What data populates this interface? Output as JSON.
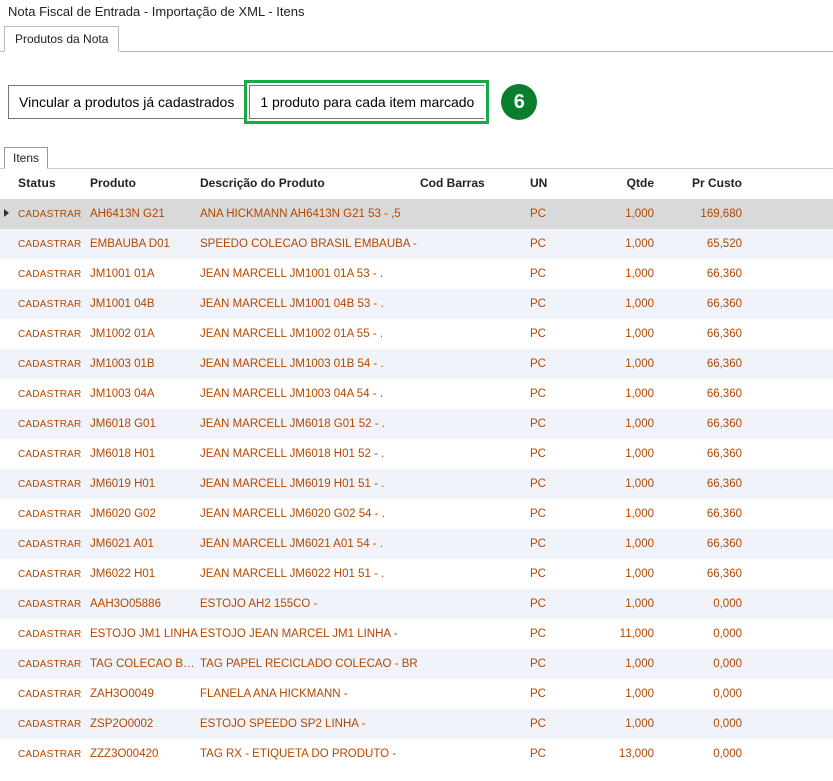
{
  "window": {
    "title": "Nota Fiscal de Entrada - Importação de XML - Itens"
  },
  "tabs_outer": {
    "active": "Produtos da Nota"
  },
  "toolbar": {
    "btn_link": "Vincular a produtos já cadastrados",
    "btn_create": "1 produto para cada item marcado"
  },
  "callout": {
    "number": "6"
  },
  "subtabs": {
    "active": "Itens"
  },
  "grid": {
    "columns": {
      "status": "Status",
      "produto": "Produto",
      "descricao": "Descrição do Produto",
      "cod_barras": "Cod Barras",
      "un": "UN",
      "qtde": "Qtde",
      "pr_custo": "Pr Custo"
    },
    "status_label": "CADASTRAR",
    "rows": [
      {
        "selected": true,
        "produto": "AH6413N G21",
        "descricao": "ANA HICKMANN AH6413N G21 53 - ,5",
        "un": "PC",
        "qtde": "1,000",
        "custo": "169,680"
      },
      {
        "selected": false,
        "produto": "EMBAUBA D01",
        "descricao": "SPEEDO COLECAO BRASIL EMBAUBA - ",
        "un": "PC",
        "qtde": "1,000",
        "custo": "65,520"
      },
      {
        "selected": false,
        "produto": "JM1001 01A",
        "descricao": "JEAN MARCELL JM1001 01A 53 - .",
        "un": "PC",
        "qtde": "1,000",
        "custo": "66,360"
      },
      {
        "selected": false,
        "produto": "JM1001 04B",
        "descricao": "JEAN MARCELL JM1001 04B 53 - .",
        "un": "PC",
        "qtde": "1,000",
        "custo": "66,360"
      },
      {
        "selected": false,
        "produto": "JM1002 01A",
        "descricao": "JEAN MARCELL JM1002 01A 55 - .",
        "un": "PC",
        "qtde": "1,000",
        "custo": "66,360"
      },
      {
        "selected": false,
        "produto": "JM1003 01B",
        "descricao": "JEAN MARCELL JM1003 01B 54 - .",
        "un": "PC",
        "qtde": "1,000",
        "custo": "66,360"
      },
      {
        "selected": false,
        "produto": "JM1003 04A",
        "descricao": "JEAN MARCELL JM1003 04A 54 - .",
        "un": "PC",
        "qtde": "1,000",
        "custo": "66,360"
      },
      {
        "selected": false,
        "produto": "JM6018 G01",
        "descricao": "JEAN MARCELL JM6018 G01 52 - .",
        "un": "PC",
        "qtde": "1,000",
        "custo": "66,360"
      },
      {
        "selected": false,
        "produto": "JM6018 H01",
        "descricao": "JEAN MARCELL JM6018 H01 52 - .",
        "un": "PC",
        "qtde": "1,000",
        "custo": "66,360"
      },
      {
        "selected": false,
        "produto": "JM6019 H01",
        "descricao": "JEAN MARCELL JM6019 H01 51 - .",
        "un": "PC",
        "qtde": "1,000",
        "custo": "66,360"
      },
      {
        "selected": false,
        "produto": "JM6020 G02",
        "descricao": "JEAN MARCELL JM6020 G02 54 - .",
        "un": "PC",
        "qtde": "1,000",
        "custo": "66,360"
      },
      {
        "selected": false,
        "produto": "JM6021 A01",
        "descricao": "JEAN MARCELL JM6021 A01 54 - .",
        "un": "PC",
        "qtde": "1,000",
        "custo": "66,360"
      },
      {
        "selected": false,
        "produto": "JM6022 H01",
        "descricao": "JEAN MARCELL JM6022 H01 51 - .",
        "un": "PC",
        "qtde": "1,000",
        "custo": "66,360"
      },
      {
        "selected": false,
        "produto": "AAH3O05886",
        "descricao": "ESTOJO AH2 155CO -",
        "un": "PC",
        "qtde": "1,000",
        "custo": "0,000"
      },
      {
        "selected": false,
        "produto": "ESTOJO JM1 LINHA",
        "descricao": "ESTOJO JEAN MARCEL JM1 LINHA -",
        "un": "PC",
        "qtde": "11,000",
        "custo": "0,000"
      },
      {
        "selected": false,
        "produto": "TAG COLECAO BRAS",
        "descricao": "TAG PAPEL RECICLADO COLECAO - BR",
        "un": "PC",
        "qtde": "1,000",
        "custo": "0,000"
      },
      {
        "selected": false,
        "produto": "ZAH3O0049",
        "descricao": "FLANELA ANA HICKMANN -",
        "un": "PC",
        "qtde": "1,000",
        "custo": "0,000"
      },
      {
        "selected": false,
        "produto": "ZSP2O0002",
        "descricao": "ESTOJO SPEEDO SP2 LINHA -",
        "un": "PC",
        "qtde": "1,000",
        "custo": "0,000"
      },
      {
        "selected": false,
        "produto": "ZZZ3O00420",
        "descricao": "TAG RX - ETIQUETA DO PRODUTO -",
        "un": "PC",
        "qtde": "13,000",
        "custo": "0,000"
      }
    ]
  }
}
